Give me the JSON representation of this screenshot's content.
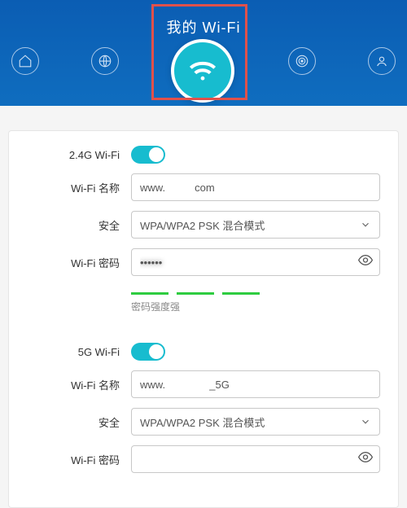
{
  "header": {
    "title": "我的 Wi-Fi"
  },
  "wifi24": {
    "section_label": "2.4G Wi-Fi",
    "enabled": true,
    "name_label": "Wi-Fi 名称",
    "name_value": "www.          com",
    "security_label": "安全",
    "security_value": "WPA/WPA2 PSK 混合模式",
    "password_label": "Wi-Fi 密码",
    "password_value": "••••••",
    "strength_label": "密码强度强"
  },
  "wifi5g": {
    "section_label": "5G Wi-Fi",
    "enabled": true,
    "name_label": "Wi-Fi 名称",
    "name_value": "www.               _5G",
    "security_label": "安全",
    "security_value": "WPA/WPA2 PSK 混合模式",
    "password_label": "Wi-Fi 密码",
    "password_value": ""
  }
}
